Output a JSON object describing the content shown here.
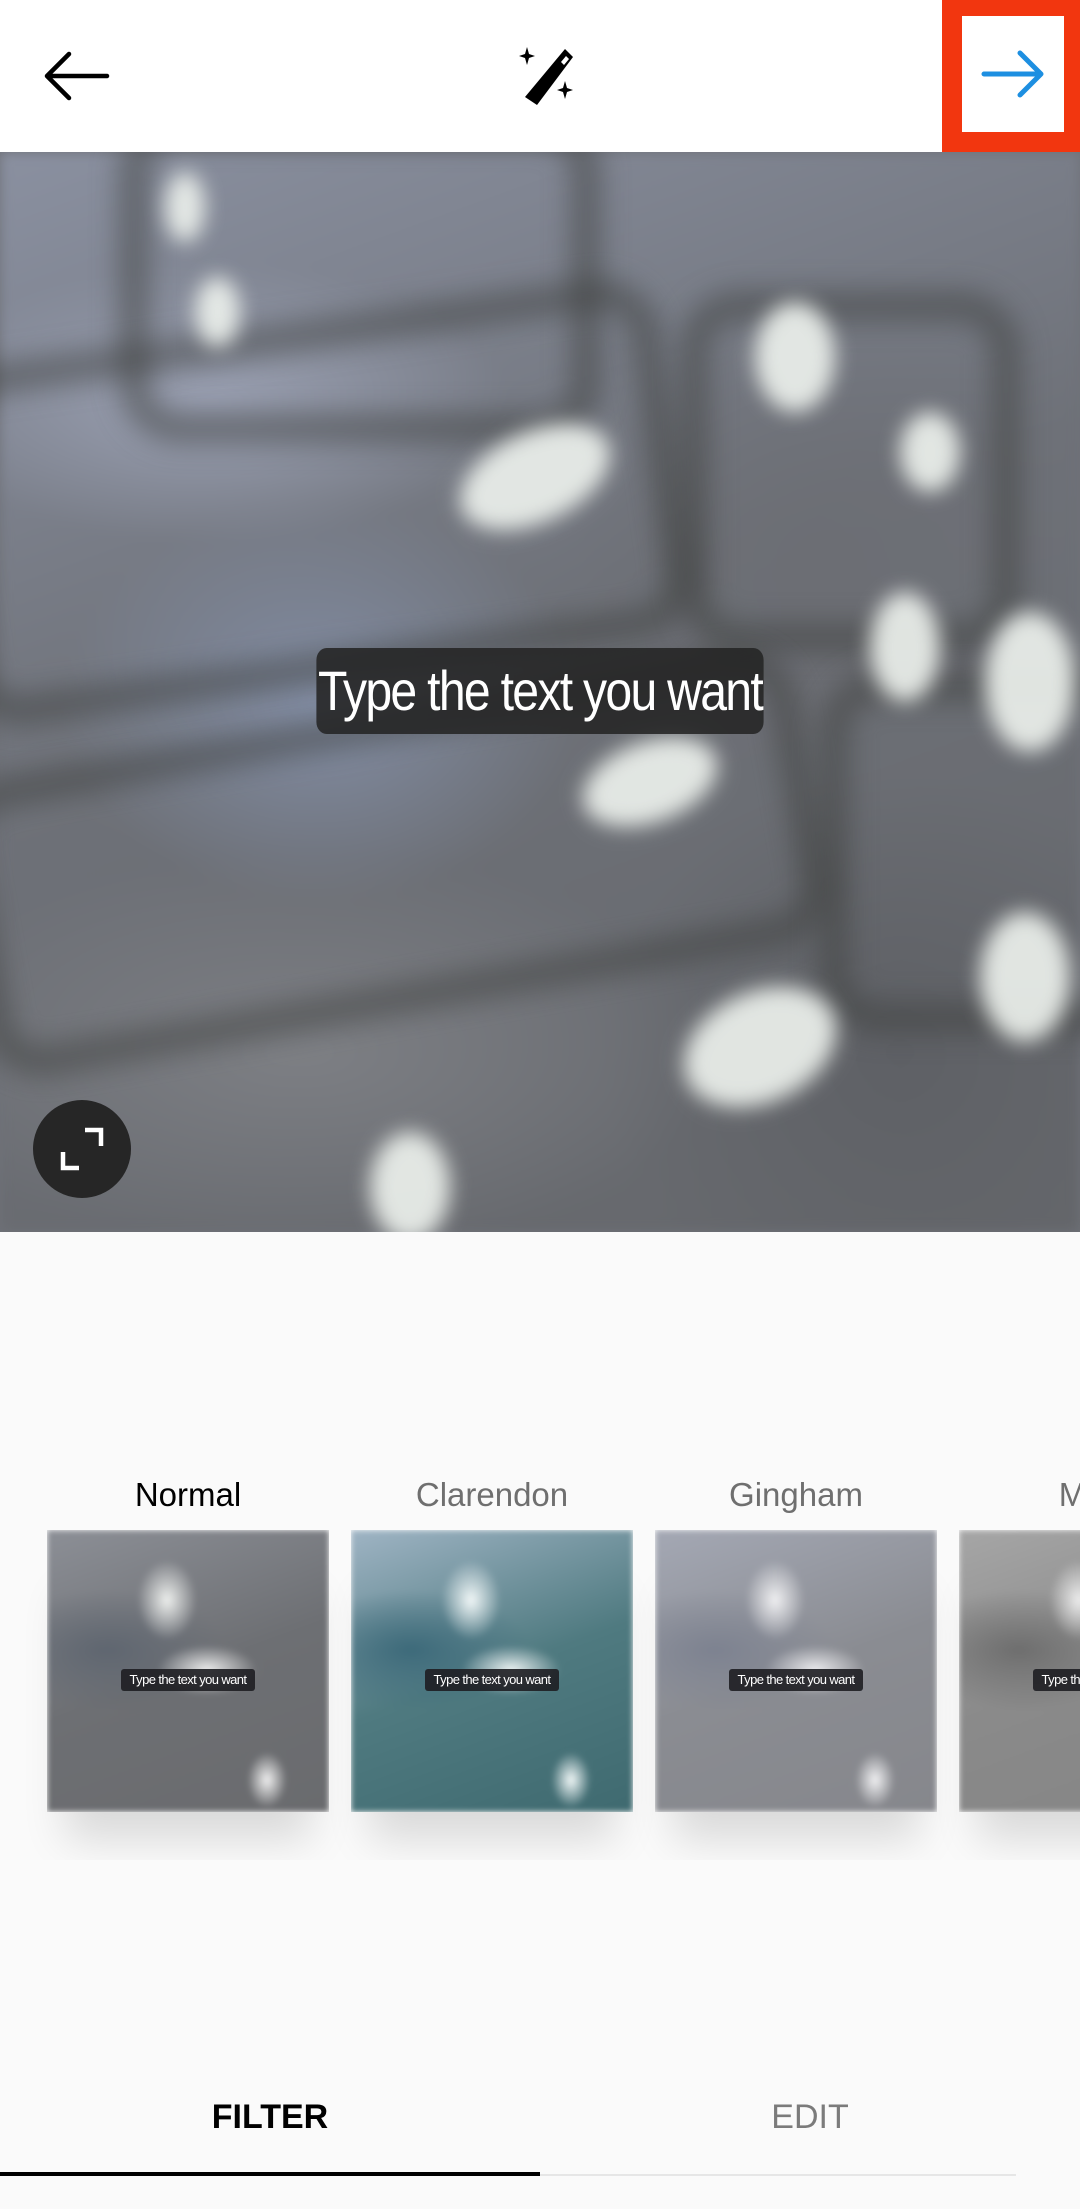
{
  "topbar": {
    "back_icon": "arrow-left-icon",
    "magic_icon": "magic-wand-icon",
    "next_icon": "arrow-right-icon",
    "next_icon_color": "#1d8fe1",
    "highlight_color": "#f2360f"
  },
  "preview": {
    "caption_text": "Type the text you want",
    "expand_icon": "expand-icon"
  },
  "filters": [
    {
      "label": "Normal",
      "active": true,
      "caption": "Type the text you want"
    },
    {
      "label": "Clarendon",
      "active": false,
      "caption": "Type the text you want"
    },
    {
      "label": "Gingham",
      "active": false,
      "caption": "Type the text you want"
    },
    {
      "label": "Moon",
      "active": false,
      "caption": "Type the text you want"
    }
  ],
  "tabs": {
    "filter_label": "FILTER",
    "edit_label": "EDIT",
    "active": "FILTER"
  }
}
